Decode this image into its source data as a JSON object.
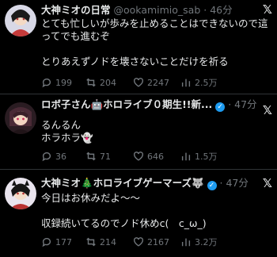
{
  "tweets": [
    {
      "name": "大神ミオの日常",
      "handle": "@ookamimio_sab",
      "dot": "·",
      "time": "46分",
      "body": "とても忙しいが歩みを止めることはできないので這ってでも進むぞ\n\nとりあえずノドを壊さないことだけを祈る",
      "replies": "199",
      "retweets": "204",
      "likes": "2247",
      "views": "2.5万"
    },
    {
      "name": "ロボ子さん🤖ホロライブ０期生!!新...",
      "verified": "✓",
      "dot": "·",
      "time": "47分",
      "body": "るんるん\nホラホラ👻",
      "replies": "36",
      "retweets": "71",
      "likes": "646",
      "views": "1.5万"
    },
    {
      "name": "大神ミオ🎄ホロライブゲーマーズ🐺",
      "verified": "✓",
      "dot": "·",
      "time": "47分",
      "body": "今日はお休みだよ～～\n\n収録続いてるのでノド休めc(　c_ω_)",
      "replies": "177",
      "retweets": "214",
      "likes": "2167",
      "views": "3.2万"
    }
  ],
  "icons": {
    "x_logo": "𝕏",
    "reply": "reply-icon",
    "retweet": "retweet-icon",
    "like": "heart-icon",
    "views": "views-icon"
  },
  "colors": {
    "background": "#000000",
    "text": "#e7e9ea",
    "muted": "#71767b",
    "verified": "#1d9bf0",
    "divider": "#2f3336"
  }
}
